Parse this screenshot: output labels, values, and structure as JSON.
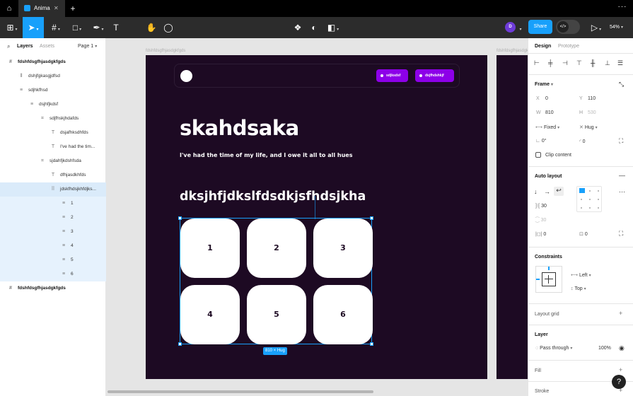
{
  "tabs": {
    "active": "Anima",
    "close": "✕",
    "new": "+",
    "more": "···"
  },
  "toolbar": {
    "share": "Share",
    "avatar_initial": "D",
    "zoom": "54%",
    "devmode_icon": "</>"
  },
  "left_panel": {
    "tabs": [
      "Layers",
      "Assets"
    ],
    "page": "Page 1",
    "layers": [
      {
        "name": "fdshfdsgfhjasdgkfgds",
        "icon": "frame-icon",
        "indent": 0,
        "bold": true
      },
      {
        "name": "dshjfgkasgjdfsd",
        "icon": "vertical-layout-icon",
        "indent": 1
      },
      {
        "name": "sdjhkfhsd",
        "icon": "horizontal-layout-icon",
        "indent": 1
      },
      {
        "name": "dsjhfjkdsf",
        "icon": "horizontal-layout-icon",
        "indent": 2
      },
      {
        "name": "sdjfhskjhdafds",
        "icon": "grid-icon",
        "indent": 3
      },
      {
        "name": "dsjafhksdhfds",
        "icon": "text-icon",
        "indent": 4
      },
      {
        "name": "I've had the tim...",
        "icon": "text-icon",
        "indent": 4
      },
      {
        "name": "sjdahfjkdshfsda",
        "icon": "grid-icon",
        "indent": 3
      },
      {
        "name": "dfhjasdkhfds",
        "icon": "text-icon",
        "indent": 4
      },
      {
        "name": "jdskfhdsjkhfdjks...",
        "icon": "wrap-layout-icon",
        "indent": 4,
        "selected": true
      },
      {
        "name": "1",
        "icon": "horizontal-layout-icon",
        "indent": 5
      },
      {
        "name": "2",
        "icon": "horizontal-layout-icon",
        "indent": 5
      },
      {
        "name": "3",
        "icon": "horizontal-layout-icon",
        "indent": 5
      },
      {
        "name": "4",
        "icon": "horizontal-layout-icon",
        "indent": 5
      },
      {
        "name": "5",
        "icon": "horizontal-layout-icon",
        "indent": 5
      },
      {
        "name": "6",
        "icon": "horizontal-layout-icon",
        "indent": 5
      },
      {
        "name": "fdshfdsgfhjasdgkfgds",
        "icon": "frame-icon",
        "indent": 0,
        "bold": true
      }
    ]
  },
  "canvas": {
    "frame_label": "fdshfdsgfhjasdgkfgds",
    "frame2_label": "fdshfdsgfhjasdgkfgds",
    "nav_buttons": [
      "sdjksdsf",
      "dsjfhdshkjf"
    ],
    "heading": "skahdsaka",
    "subheading": "I've had the time of my life, and I owe it all to all hues",
    "heading2": "dksjhfjdkslfdsdkjsfhdsjkha",
    "cards": [
      "1",
      "2",
      "3",
      "4",
      "5",
      "6"
    ],
    "size_badge": "810 × Hug"
  },
  "right_panel": {
    "tabs": [
      "Design",
      "Prototype"
    ],
    "frame": {
      "title": "Frame",
      "x_label": "X",
      "x": "0",
      "y_label": "Y",
      "y": "110",
      "w_label": "W",
      "w": "810",
      "h_label": "H",
      "h": "530",
      "width_mode": "Fixed",
      "height_mode": "Hug",
      "rotation": "0°",
      "radius": "0",
      "clip_content": "Clip content"
    },
    "auto_layout": {
      "title": "Auto layout",
      "gap": "30",
      "gap_disabled": "30",
      "padding_h": "0",
      "padding_v": "0"
    },
    "constraints": {
      "title": "Constraints",
      "horizontal": "Left",
      "vertical": "Top"
    },
    "layout_grid": {
      "title": "Layout grid"
    },
    "layer": {
      "title": "Layer",
      "blend": "Pass through",
      "opacity": "100%"
    },
    "fill": {
      "title": "Fill"
    },
    "stroke": {
      "title": "Stroke"
    }
  },
  "help": "?"
}
